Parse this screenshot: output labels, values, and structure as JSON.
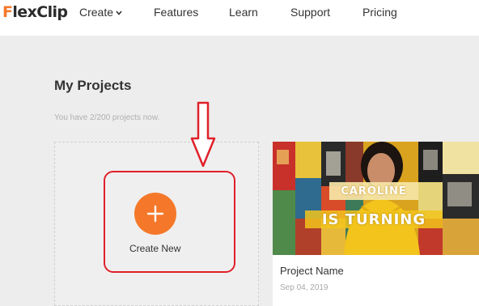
{
  "brand": {
    "logo_initial": "F",
    "logo_rest": "lexClip",
    "accent_color": "#f5782a"
  },
  "nav": {
    "create": "Create",
    "features": "Features",
    "learn": "Learn",
    "support": "Support",
    "pricing": "Pricing"
  },
  "page": {
    "title": "My Projects",
    "subtitle": "You have 2/200 projects now."
  },
  "create_card": {
    "label": "Create New",
    "icon": "plus-icon"
  },
  "project": {
    "thumb_line1": "CAROLINE",
    "thumb_line2": "IS TURNING",
    "name": "Project Name",
    "date": "Sep 04, 2019"
  },
  "annotation": {
    "highlight_color": "#e0202a"
  }
}
